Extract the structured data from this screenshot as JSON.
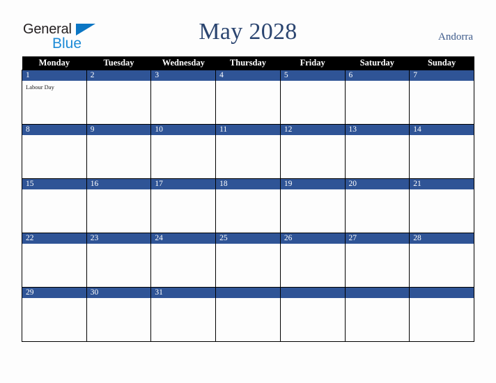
{
  "brand": {
    "name_part1": "General",
    "name_part2": "Blue",
    "triangle_color": "#0b76c4",
    "blue_color": "#1c8ad6",
    "dark_color": "#231f20"
  },
  "header": {
    "title": "May 2028",
    "country": "Andorra",
    "title_color": "#2b4570",
    "country_color": "#3d5a8a"
  },
  "calendar": {
    "month": "May",
    "year": "2028",
    "first_day_of_week": "Monday",
    "header_background": "#000000",
    "header_text_color": "#ffffff",
    "daynum_background": "#2f5496",
    "daynum_text_color": "#ffffff",
    "cell_background": "#fdfdfd",
    "border_color": "#000000",
    "weekdays": [
      "Monday",
      "Tuesday",
      "Wednesday",
      "Thursday",
      "Friday",
      "Saturday",
      "Sunday"
    ],
    "weeks": [
      [
        {
          "day": "1",
          "event": "Labour Day"
        },
        {
          "day": "2",
          "event": ""
        },
        {
          "day": "3",
          "event": ""
        },
        {
          "day": "4",
          "event": ""
        },
        {
          "day": "5",
          "event": ""
        },
        {
          "day": "6",
          "event": ""
        },
        {
          "day": "7",
          "event": ""
        }
      ],
      [
        {
          "day": "8",
          "event": ""
        },
        {
          "day": "9",
          "event": ""
        },
        {
          "day": "10",
          "event": ""
        },
        {
          "day": "11",
          "event": ""
        },
        {
          "day": "12",
          "event": ""
        },
        {
          "day": "13",
          "event": ""
        },
        {
          "day": "14",
          "event": ""
        }
      ],
      [
        {
          "day": "15",
          "event": ""
        },
        {
          "day": "16",
          "event": ""
        },
        {
          "day": "17",
          "event": ""
        },
        {
          "day": "18",
          "event": ""
        },
        {
          "day": "19",
          "event": ""
        },
        {
          "day": "20",
          "event": ""
        },
        {
          "day": "21",
          "event": ""
        }
      ],
      [
        {
          "day": "22",
          "event": ""
        },
        {
          "day": "23",
          "event": ""
        },
        {
          "day": "24",
          "event": ""
        },
        {
          "day": "25",
          "event": ""
        },
        {
          "day": "26",
          "event": ""
        },
        {
          "day": "27",
          "event": ""
        },
        {
          "day": "28",
          "event": ""
        }
      ],
      [
        {
          "day": "29",
          "event": ""
        },
        {
          "day": "30",
          "event": ""
        },
        {
          "day": "31",
          "event": ""
        },
        {
          "day": "",
          "event": ""
        },
        {
          "day": "",
          "event": ""
        },
        {
          "day": "",
          "event": ""
        },
        {
          "day": "",
          "event": ""
        }
      ]
    ]
  }
}
